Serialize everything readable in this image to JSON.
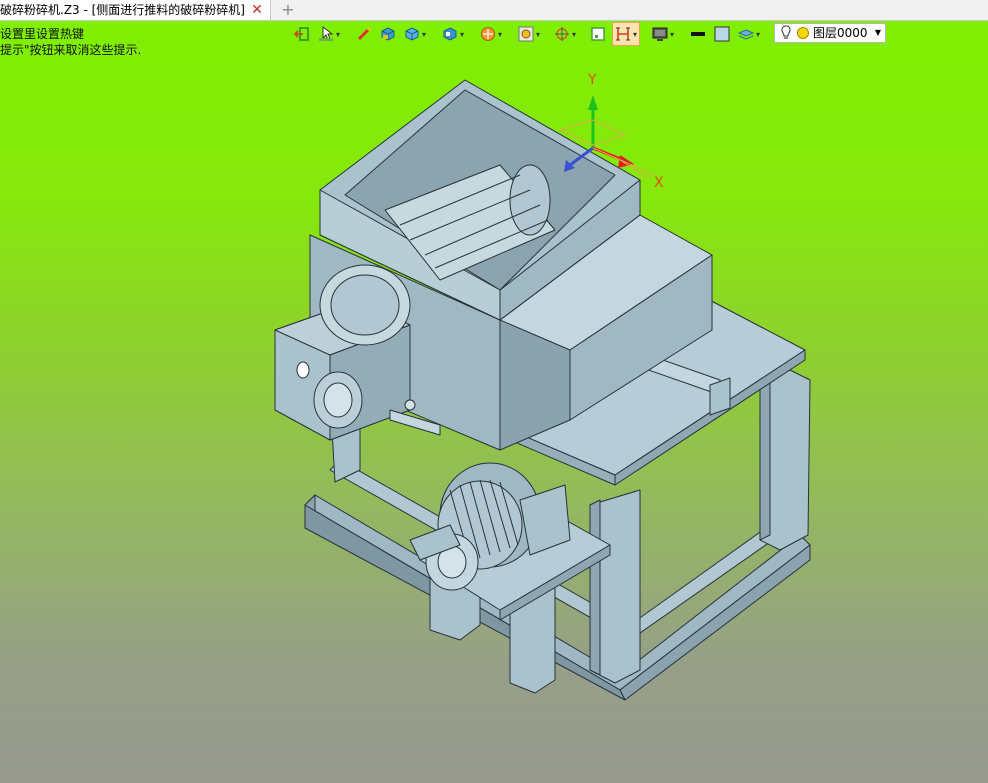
{
  "tabs": [
    {
      "title": "破碎粉碎机.Z3 - [侧面进行推料的破碎粉碎机]",
      "close_icon": "close-icon"
    }
  ],
  "new_tab_icon": "plus-icon",
  "hints": {
    "line1": "设置里设置热键",
    "line2": "提示\"按钮来取消这些提示."
  },
  "toolbar": {
    "items": [
      {
        "name": "exit-icon"
      },
      {
        "name": "select-filter-icon"
      },
      {
        "name": "pick-icon"
      },
      {
        "name": "solid-icon"
      },
      {
        "name": "cube-icon"
      },
      {
        "name": "view-cube-icon"
      },
      {
        "name": "render-mode-icon"
      },
      {
        "name": "zoom-icon"
      },
      {
        "name": "orient-icon"
      },
      {
        "name": "frame-icon"
      },
      {
        "name": "section-icon"
      },
      {
        "name": "display-icon"
      },
      {
        "name": "line-color-icon"
      },
      {
        "name": "face-color-icon"
      },
      {
        "name": "layer-icon"
      }
    ],
    "layer_combo": {
      "value": "图层0000",
      "bulb_icon": "lightbulb-icon"
    }
  },
  "axes": {
    "y_label": "Y",
    "x_label": "X"
  },
  "colors": {
    "accent_orange": "#e3a64a",
    "model_blue": "#a9c2cc",
    "edge_dark": "#2a3338"
  }
}
